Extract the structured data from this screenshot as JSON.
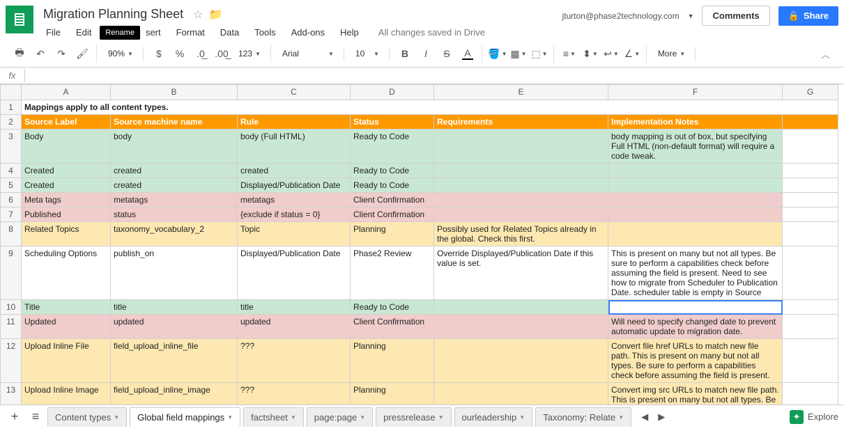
{
  "doc_title": "Migration Planning Sheet",
  "user_email": "jturton@phase2technology.com",
  "comments_label": "Comments",
  "share_label": "Share",
  "tooltip": "Rename",
  "save_status": "All changes saved in Drive",
  "menu": {
    "file": "File",
    "edit": "Edit",
    "insert": "Insert",
    "format": "Format",
    "data": "Data",
    "tools": "Tools",
    "addons": "Add-ons",
    "help": "Help"
  },
  "toolbar": {
    "zoom": "90%",
    "font": "Arial",
    "size": "10",
    "more": "More",
    "num_fmt": "123"
  },
  "fx": "fx",
  "cols": [
    "A",
    "B",
    "C",
    "D",
    "E",
    "F",
    "G"
  ],
  "subtitle": "Mappings apply to all content types.",
  "headers": {
    "a": "Source Label",
    "b": "Source machine name",
    "c": "Rule",
    "d": "Status",
    "e": "Requirements",
    "f": "Implementation Notes"
  },
  "rows": [
    {
      "n": "3",
      "cls": "green",
      "a": "Body",
      "b": "body",
      "c": "body (Full HTML)",
      "d": "Ready to Code",
      "e": "",
      "f": "body mapping is out of box, but specifying Full HTML (non-default format) will require a code tweak."
    },
    {
      "n": "4",
      "cls": "green",
      "a": "Created",
      "b": "created",
      "c": "created",
      "d": "Ready to Code",
      "e": "",
      "f": ""
    },
    {
      "n": "5",
      "cls": "green",
      "a": "Created",
      "b": "created",
      "c": "Displayed/Publication Date",
      "d": "Ready to Code",
      "e": "",
      "f": ""
    },
    {
      "n": "6",
      "cls": "pink",
      "a": "Meta tags",
      "b": "metatags",
      "c": "metatags",
      "d": "Client Confirmation",
      "e": "",
      "f": ""
    },
    {
      "n": "7",
      "cls": "pink",
      "a": "Published",
      "b": "status",
      "c": "{exclude if status = 0}",
      "d": "Client Confirmation",
      "e": "",
      "f": ""
    },
    {
      "n": "8",
      "cls": "yellow",
      "a": "Related Topics",
      "b": "taxonomy_vocabulary_2",
      "c": "Topic",
      "d": "Planning",
      "e": "Possibly used for Related Topics already in the global. Check this first.",
      "f": ""
    },
    {
      "n": "9",
      "cls": "white",
      "a": "Scheduling Options",
      "b": "publish_on",
      "c": "Displayed/Publication Date",
      "d": "Phase2 Review",
      "e": "Override Displayed/Publication Date if this value is set.",
      "f": "This is present on many but not all types. Be sure to perform a capabilities check before assuming the field is present. Need to see how to migrate from Scheduler to Publication Date. scheduler table is empty in Source"
    },
    {
      "n": "10",
      "cls": "green",
      "a": "Title",
      "b": "title",
      "c": "title",
      "d": "Ready to Code",
      "e": "",
      "f": "",
      "active": true
    },
    {
      "n": "11",
      "cls": "pink",
      "a": "Updated",
      "b": "updated",
      "c": "updated",
      "d": "Client Confirmation",
      "e": "",
      "f": "Will need to specify changed date to prevent automatic update to migration date."
    },
    {
      "n": "12",
      "cls": "yellow",
      "a": "Upload Inline File",
      "b": "field_upload_inline_file",
      "c": "???",
      "d": "Planning",
      "e": "",
      "f": "Convert file href URLs to match new file path. This is present on many but not all types. Be sure to perform a capabilities check before assuming the field is present."
    },
    {
      "n": "13",
      "cls": "yellow",
      "a": "Upload Inline Image",
      "b": "field_upload_inline_image",
      "c": "???",
      "d": "Planning",
      "e": "",
      "f": "Convert img src URLs to match new file path. This is present on many but not all types. Be sure to perform a capabilities check before assuming the field is present."
    }
  ],
  "tabs": [
    {
      "label": "Content types",
      "active": false
    },
    {
      "label": "Global field mappings",
      "active": true
    },
    {
      "label": "factsheet",
      "active": false
    },
    {
      "label": "page:page",
      "active": false
    },
    {
      "label": "pressrelease",
      "active": false
    },
    {
      "label": "ourleadership",
      "active": false
    },
    {
      "label": "Taxonomy: Relate",
      "active": false
    }
  ],
  "explore": "Explore"
}
